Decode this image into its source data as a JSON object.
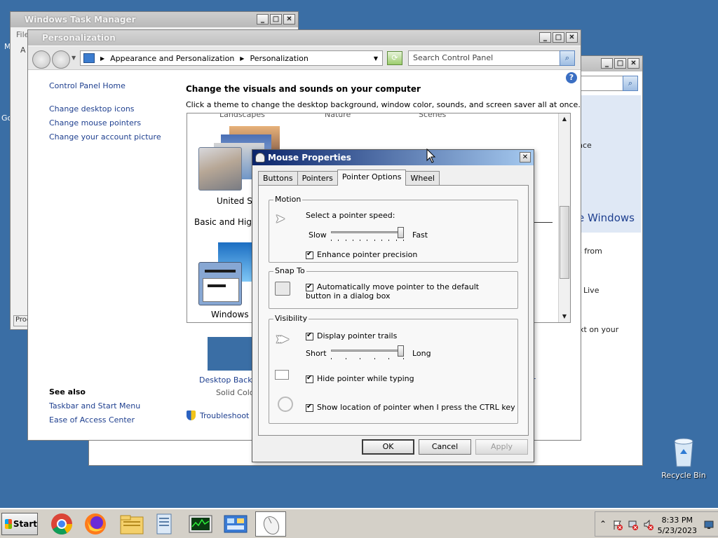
{
  "desktop": {
    "recycle_bin": "Recycle Bin",
    "left_edge_1": "M",
    "left_edge_2": "Go"
  },
  "task_manager": {
    "title": "Windows Task Manager",
    "menu_partial": "File",
    "tab_partial": "A",
    "proc_partial": "Proc"
  },
  "control_panel_back": {
    "partial_1": "nce",
    "partial_2": "e Windows",
    "partial_3": "s from",
    "partial_4": "Live",
    "partial_5": "xt on your"
  },
  "personalization": {
    "title": "Personalization",
    "breadcrumb": [
      "Appearance and Personalization",
      "Personalization"
    ],
    "search_placeholder": "Search Control Panel",
    "left_links": {
      "home": "Control Panel Home",
      "items": [
        "Change desktop icons",
        "Change mouse pointers",
        "Change your account picture"
      ]
    },
    "see_also": {
      "header": "See also",
      "items": [
        "Taskbar and Start Menu",
        "Ease of Access Center"
      ]
    },
    "heading": "Change the visuals and sounds on your computer",
    "description": "Click a theme to change the desktop background, window color, sounds, and screen saver all at once.",
    "cut_labels": [
      "Landscapes",
      "Nature",
      "Scenes"
    ],
    "themes": {
      "united": "United St",
      "basic_header": "Basic and High",
      "win7": "Windows 7"
    },
    "bottom": {
      "bg_label": "Desktop Backgr",
      "bg_sub": "Solid Color",
      "saver": "ver",
      "troubleshoot": "Troubleshoot p"
    }
  },
  "mouse_dialog": {
    "title": "Mouse Properties",
    "tabs": [
      "Buttons",
      "Pointers",
      "Pointer Options",
      "Wheel"
    ],
    "active_tab": "Pointer Options",
    "motion": {
      "label": "Motion",
      "speed_label": "Select a pointer speed:",
      "slow": "Slow",
      "fast": "Fast",
      "speed_value_fraction": 1.0,
      "enhance": "Enhance pointer precision",
      "enhance_checked": true
    },
    "snap_to": {
      "label": "Snap To",
      "text": "Automatically move pointer to the default button in a dialog box",
      "checked": true
    },
    "visibility": {
      "label": "Visibility",
      "trails": "Display pointer trails",
      "trails_checked": true,
      "short": "Short",
      "long": "Long",
      "trails_value_fraction": 1.0,
      "hide": "Hide pointer while typing",
      "hide_checked": true,
      "ctrl": "Show location of pointer when I press the CTRL key",
      "ctrl_checked": true
    },
    "buttons": {
      "ok": "OK",
      "cancel": "Cancel",
      "apply": "Apply"
    }
  },
  "taskbar": {
    "start": "Start",
    "time": "8:33 PM",
    "date": "5/23/2023"
  }
}
